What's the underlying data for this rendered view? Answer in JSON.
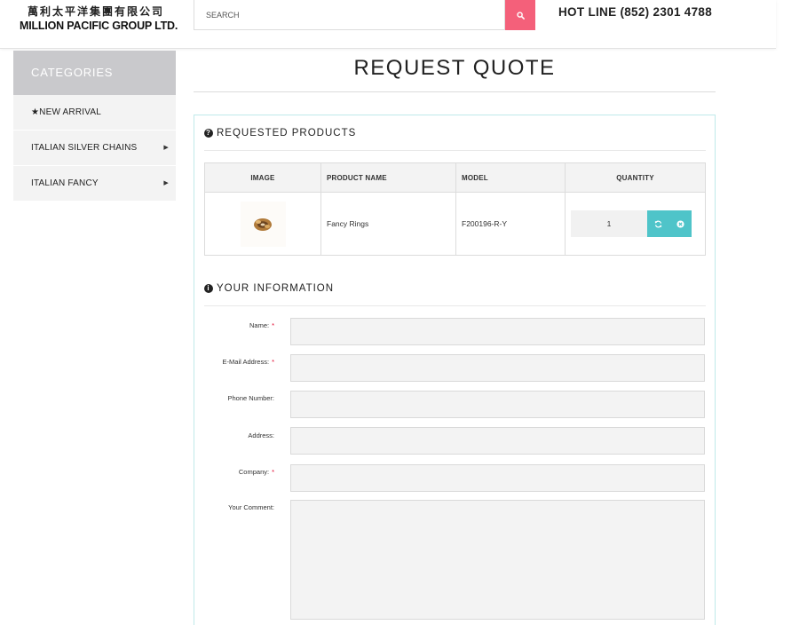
{
  "header": {
    "logo_cn": "萬利太平洋集團有限公司",
    "logo_en": "MILLION PACIFIC GROUP LTD.",
    "search_placeholder": "SEARCH",
    "hotline": "HOT LINE (852) 2301 4788"
  },
  "sidebar": {
    "header": "CATEGORIES",
    "items": [
      {
        "label": "★NEW ARRIVAL",
        "has_arrow": false
      },
      {
        "label": "ITALIAN SILVER CHAINS",
        "has_arrow": true
      },
      {
        "label": "ITALIAN FANCY",
        "has_arrow": true
      }
    ]
  },
  "page": {
    "title": "REQUEST QUOTE"
  },
  "products_section": {
    "title": "REQUESTED PRODUCTS",
    "columns": {
      "image": "IMAGE",
      "name": "PRODUCT NAME",
      "model": "MODEL",
      "quantity": "QUANTITY"
    },
    "rows": [
      {
        "name": "Fancy Rings",
        "model": "F200196-R-Y",
        "quantity": "1"
      }
    ]
  },
  "info_section": {
    "title": "YOUR INFORMATION",
    "fields": {
      "name": {
        "label": "Name:",
        "required": "*"
      },
      "email": {
        "label": "E-Mail Address:",
        "required": "*"
      },
      "phone": {
        "label": "Phone Number:"
      },
      "address": {
        "label": "Address:"
      },
      "company": {
        "label": "Company:",
        "required": "*"
      },
      "comment": {
        "label": "Your Comment:"
      }
    }
  },
  "colors": {
    "accent_pink": "#f4607a",
    "accent_teal": "#4fc4c9",
    "panel_border": "#bfe9ea",
    "sidebar_header": "#c9c9cc"
  },
  "icons": {
    "search": "search-icon",
    "products": "question-circle-icon",
    "info": "info-circle-icon",
    "update": "refresh-icon",
    "remove": "remove-circle-icon",
    "arrow": "caret-right-icon"
  }
}
